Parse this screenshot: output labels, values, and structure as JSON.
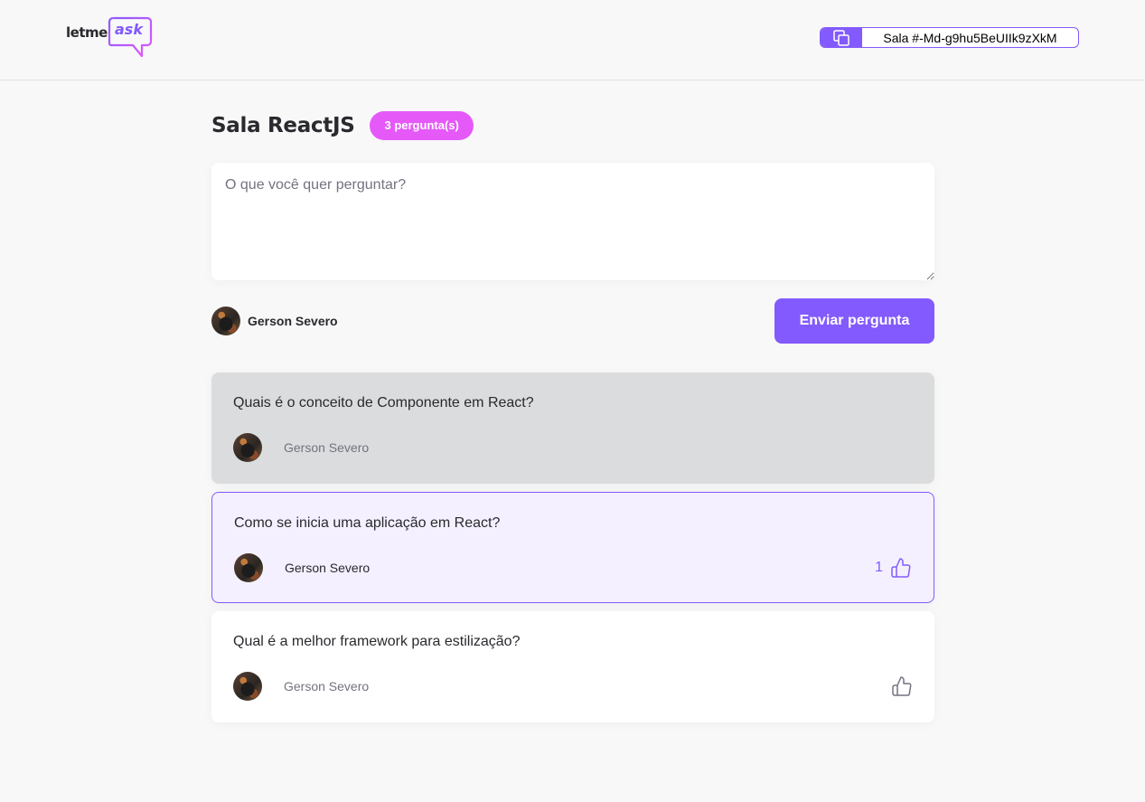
{
  "header": {
    "logo_text_left": "letme",
    "logo_text_right": "ask",
    "room_code_label": "Sala #-Md-g9hu5BeUIIk9zXkM",
    "copy_icon": "copy-icon"
  },
  "room": {
    "title": "Sala ReactJS",
    "question_count_label": "3 pergunta(s)"
  },
  "form": {
    "placeholder": "O que você quer perguntar?",
    "value": "",
    "user_name": "Gerson Severo",
    "submit_label": "Enviar pergunta"
  },
  "questions": [
    {
      "content": "Quais é o conceito de Componente em React?",
      "author": "Gerson Severo",
      "state": "answered"
    },
    {
      "content": "Como se inicia uma aplicação em React?",
      "author": "Gerson Severo",
      "state": "highlighted",
      "like_count": "1"
    },
    {
      "content": "Qual é a melhor framework para estilização?",
      "author": "Gerson Severo",
      "state": "normal"
    }
  ],
  "colors": {
    "accent": "#835afd",
    "badge": "#e559f9",
    "answered_bg": "#dbdcdd",
    "highlighted_bg": "#f4f0ff"
  }
}
